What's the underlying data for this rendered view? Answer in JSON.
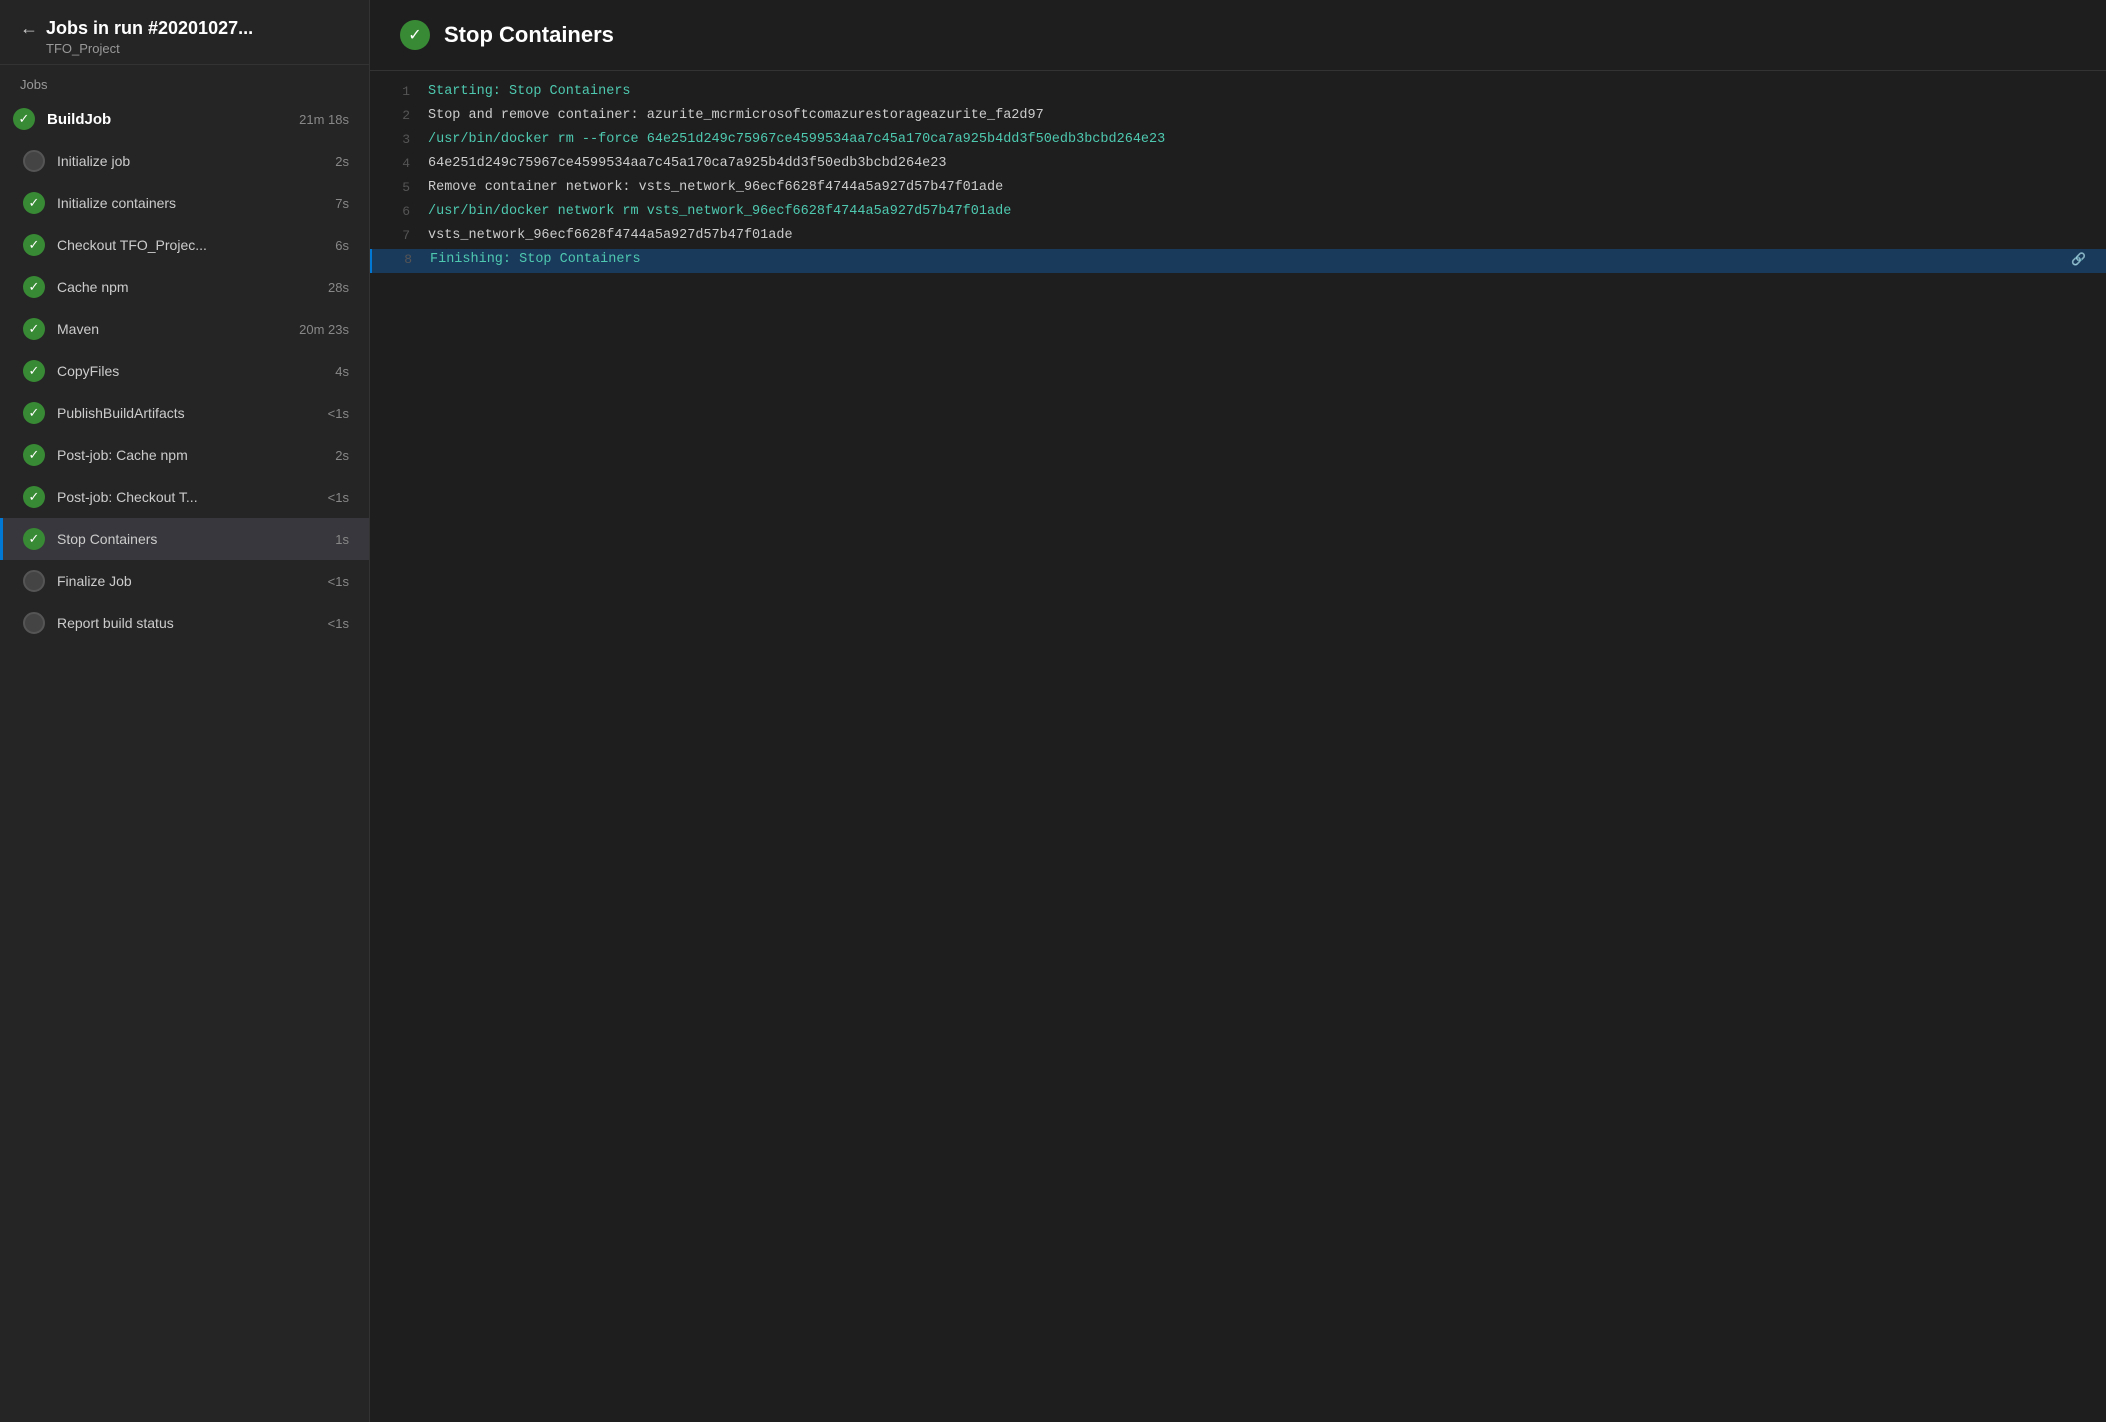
{
  "sidebar": {
    "back_label": "←",
    "title": "Jobs in run #20201027...",
    "subtitle": "TFO_Project",
    "section_label": "Jobs",
    "jobs": [
      {
        "id": "build-job",
        "name": "BuildJob",
        "duration": "21m 18s",
        "status": "success",
        "is_parent": true,
        "active": false
      },
      {
        "id": "initialize-job",
        "name": "Initialize job",
        "duration": "2s",
        "status": "pending",
        "is_parent": false,
        "active": false
      },
      {
        "id": "initialize-containers",
        "name": "Initialize containers",
        "duration": "7s",
        "status": "success",
        "is_parent": false,
        "active": false
      },
      {
        "id": "checkout-tfo",
        "name": "Checkout TFO_Projec...",
        "duration": "6s",
        "status": "success",
        "is_parent": false,
        "active": false
      },
      {
        "id": "cache-npm",
        "name": "Cache npm",
        "duration": "28s",
        "status": "success",
        "is_parent": false,
        "active": false
      },
      {
        "id": "maven",
        "name": "Maven",
        "duration": "20m 23s",
        "status": "success",
        "is_parent": false,
        "active": false
      },
      {
        "id": "copy-files",
        "name": "CopyFiles",
        "duration": "4s",
        "status": "success",
        "is_parent": false,
        "active": false
      },
      {
        "id": "publish-build-artifacts",
        "name": "PublishBuildArtifacts",
        "duration": "<1s",
        "status": "success",
        "is_parent": false,
        "active": false
      },
      {
        "id": "post-job-cache-npm",
        "name": "Post-job: Cache npm",
        "duration": "2s",
        "status": "success",
        "is_parent": false,
        "active": false
      },
      {
        "id": "post-job-checkout",
        "name": "Post-job: Checkout T...",
        "duration": "<1s",
        "status": "success",
        "is_parent": false,
        "active": false
      },
      {
        "id": "stop-containers",
        "name": "Stop Containers",
        "duration": "1s",
        "status": "success",
        "is_parent": false,
        "active": true
      },
      {
        "id": "finalize-job",
        "name": "Finalize Job",
        "duration": "<1s",
        "status": "pending",
        "is_parent": false,
        "active": false
      },
      {
        "id": "report-build-status",
        "name": "Report build status",
        "duration": "<1s",
        "status": "pending",
        "is_parent": false,
        "active": false
      }
    ]
  },
  "main": {
    "title": "Stop Containers",
    "status": "success",
    "log_lines": [
      {
        "number": 1,
        "text": "Starting: Stop Containers",
        "style": "cyan",
        "highlighted": false
      },
      {
        "number": 2,
        "text": "Stop and remove container: azurite_mcrmicrosoftcomazurestorageazurite_fa2d97",
        "style": "normal",
        "highlighted": false
      },
      {
        "number": 3,
        "text": "/usr/bin/docker rm --force 64e251d249c75967ce4599534aa7c45a170ca7a925b4dd3f50edb3bcbd264e23",
        "style": "cyan",
        "highlighted": false
      },
      {
        "number": 4,
        "text": "64e251d249c75967ce4599534aa7c45a170ca7a925b4dd3f50edb3bcbd264e23",
        "style": "normal",
        "highlighted": false
      },
      {
        "number": 5,
        "text": "Remove container network: vsts_network_96ecf6628f4744a5a927d57b47f01ade",
        "style": "normal",
        "highlighted": false
      },
      {
        "number": 6,
        "text": "/usr/bin/docker network rm vsts_network_96ecf6628f4744a5a927d57b47f01ade",
        "style": "cyan",
        "highlighted": false
      },
      {
        "number": 7,
        "text": "vsts_network_96ecf6628f4744a5a927d57b47f01ade",
        "style": "normal",
        "highlighted": false
      },
      {
        "number": 8,
        "text": "Finishing: Stop Containers",
        "style": "cyan",
        "highlighted": true,
        "has_link": true
      }
    ]
  },
  "icons": {
    "checkmark": "✓",
    "back_arrow": "←",
    "link": "🔗"
  }
}
